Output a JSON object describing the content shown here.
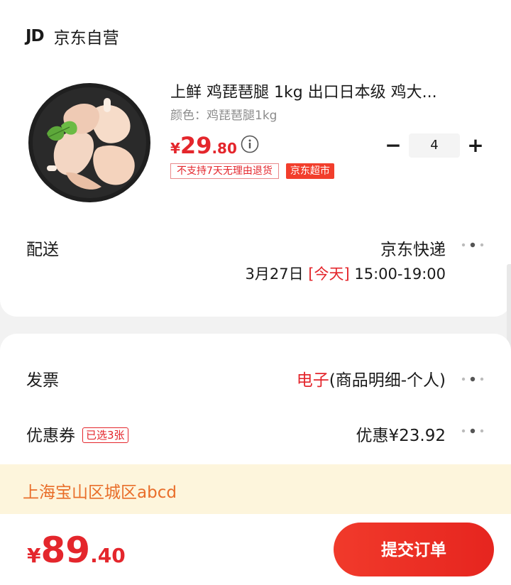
{
  "store": {
    "logo": "JD",
    "name": "京东自营"
  },
  "product": {
    "image_icon": "chicken-leg-photo",
    "title": "上鲜 鸡琵琶腿 1kg 出口日本级 鸡大...",
    "variant": "颜色：鸡琵琶腿1kg",
    "price_symbol": "¥",
    "price_int": "29",
    "price_dec": ".80",
    "quantity": "4",
    "minus_label": "−",
    "plus_label": "+",
    "tags": {
      "return_policy": "不支持7天无理由退货",
      "supermarket": "京东超市"
    }
  },
  "delivery": {
    "label": "配送",
    "carrier": "京东快递",
    "date": "3月27日",
    "today": "[今天]",
    "time": "15:00-19:00"
  },
  "invoice": {
    "label": "发票",
    "type": "电子",
    "detail": "(商品明细-个人)"
  },
  "coupon": {
    "label": "优惠券",
    "selected": "已选3张",
    "discount": "优惠¥23.92"
  },
  "address": {
    "text": "上海宝山区城区abcd"
  },
  "footer": {
    "total_symbol": "¥",
    "total_int": "89",
    "total_dec": ".40",
    "submit_label": "提交订单"
  },
  "colors": {
    "accent": "#e4262c",
    "address_bg": "#fdf5dc",
    "address_text": "#e96e2a"
  }
}
